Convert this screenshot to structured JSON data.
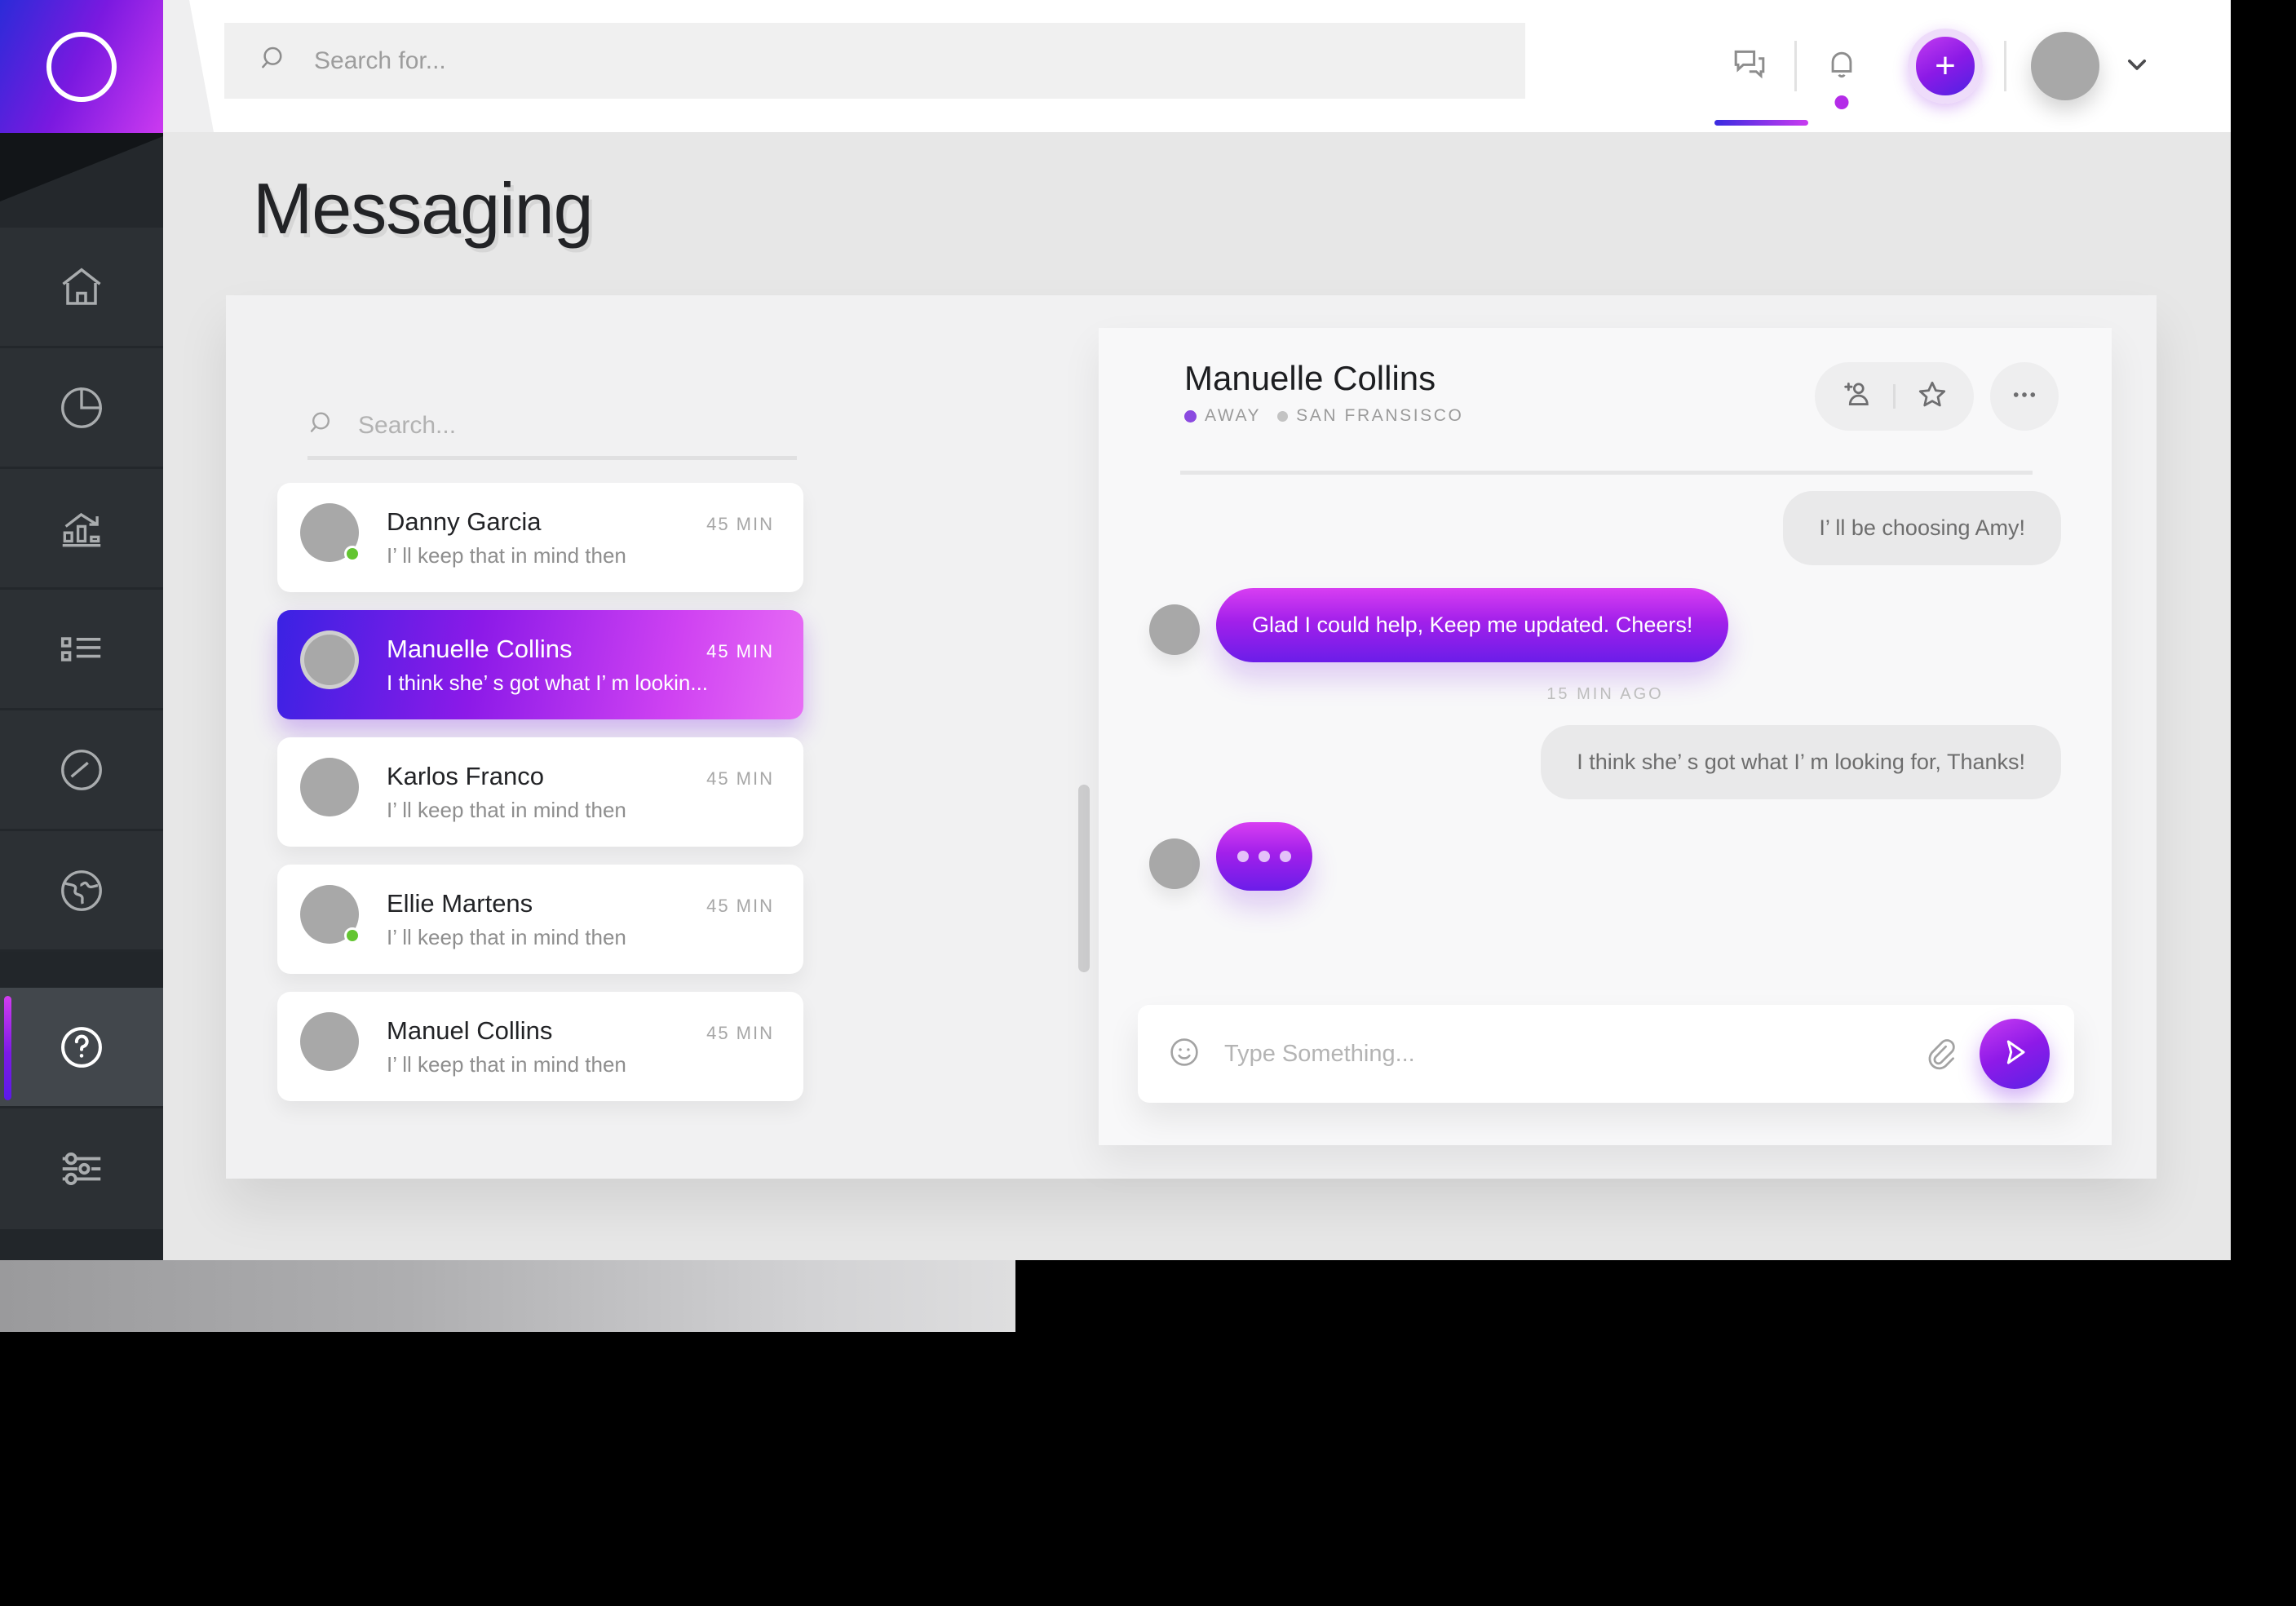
{
  "app": {
    "page_title": "Messaging",
    "logo_icon": "circle-ring-logo"
  },
  "topbar": {
    "search": {
      "placeholder": "Search for...",
      "value": "",
      "icon": "search-icon"
    },
    "messages_icon": "chat-bubble-icon",
    "notifications_icon": "bell-icon",
    "add_button_label": "+",
    "avatar_icon": "user-avatar",
    "chevron_icon": "chevron-down-icon",
    "accent_gradient_start": "#3a2ce0",
    "accent_gradient_end": "#c93bf0",
    "notification_dot_color": "#b42ce8"
  },
  "sidebar": {
    "items": [
      {
        "icon": "home-icon",
        "name": "home"
      },
      {
        "icon": "pie-chart-icon",
        "name": "analytics"
      },
      {
        "icon": "bar-chart-trend-icon",
        "name": "reports"
      },
      {
        "icon": "list-icon",
        "name": "tasks"
      },
      {
        "icon": "gauge-icon",
        "name": "performance"
      },
      {
        "icon": "globe-icon",
        "name": "network"
      },
      {
        "icon": "help-circle-icon",
        "name": "help",
        "active": true
      },
      {
        "icon": "sliders-icon",
        "name": "settings"
      }
    ],
    "active_indicator_color": "#7c1ae6"
  },
  "conversations": {
    "search": {
      "placeholder": "Search...",
      "value": "",
      "icon": "search-icon"
    },
    "items": [
      {
        "name": "Danny Garcia",
        "preview": "I’ ll keep that in mind then",
        "time": "45 MIN",
        "online": true,
        "active": false
      },
      {
        "name": "Manuelle Collins",
        "preview": "I think she’ s got what I’ m lookin...",
        "time": "45 MIN",
        "online": false,
        "active": true
      },
      {
        "name": "Karlos Franco",
        "preview": "I’ ll keep that in mind then",
        "time": "45 MIN",
        "online": false,
        "active": false
      },
      {
        "name": "Ellie Martens",
        "preview": "I’ ll keep that in mind then",
        "time": "45 MIN",
        "online": true,
        "active": false
      },
      {
        "name": "Manuel Collins",
        "preview": "I’ ll keep that in mind then",
        "time": "45 MIN",
        "online": false,
        "active": false
      }
    ]
  },
  "chat": {
    "title": "Manuelle Collins",
    "status": "AWAY",
    "location": "SAN FRANSISCO",
    "status_dot_color": "#8b4ae0",
    "actions": {
      "add_person_icon": "add-person-icon",
      "star_icon": "star-icon",
      "more_icon": "more-options-icon"
    },
    "messages": [
      {
        "text": "I’ ll be choosing Amy!",
        "direction": "out",
        "type": "text"
      },
      {
        "text": "Glad I could help, Keep me updated. Cheers!",
        "direction": "in",
        "type": "text"
      },
      {
        "text": "15 MIN AGO",
        "type": "timestamp"
      },
      {
        "text": "I think she’ s got what I’ m looking for, Thanks!",
        "direction": "out",
        "type": "text"
      },
      {
        "text": "",
        "direction": "in",
        "type": "typing"
      }
    ],
    "composer": {
      "placeholder": "Type Something...",
      "value": "",
      "emoji_icon": "emoji-smiley-icon",
      "attach_icon": "paperclip-icon",
      "send_icon": "send-paper-plane-icon"
    }
  }
}
